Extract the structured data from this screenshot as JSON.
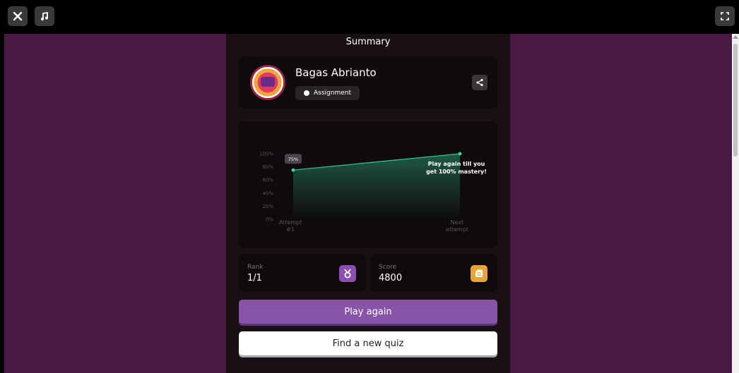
{
  "topbar": {
    "close_icon": "close-icon",
    "music_icon": "music-note-icon",
    "fullscreen_icon": "fullscreen-icon"
  },
  "summary": {
    "title": "Summary"
  },
  "user": {
    "name": "Bagas Abrianto",
    "badge": "Assignment",
    "avatar_icon": "avatar-icon",
    "share_icon": "share-icon"
  },
  "chart_data": {
    "type": "line",
    "x": [
      "Attempt #1",
      "Next attempt"
    ],
    "y_ticks": [
      "100%",
      "80%",
      "60%",
      "40%",
      "20%",
      "0%"
    ],
    "ylim": [
      0,
      100
    ],
    "series": [
      {
        "values": [
          75,
          100
        ]
      }
    ],
    "point_label": "75%",
    "annotation": "Play again till you get 100% mastery!",
    "grid": false,
    "colors": {
      "line": "#2fbf8f",
      "area_top": "#1f5e48"
    }
  },
  "stats": {
    "rank_label": "Rank",
    "rank_value": "1/1",
    "score_label": "Score",
    "score_value": "4800",
    "rank_icon": "medal-icon",
    "score_icon": "coins-icon"
  },
  "actions": {
    "play_again": "Play again",
    "find_quiz": "Find a new quiz"
  },
  "colors": {
    "stage_bg": "#4a1a44",
    "panel_bg": "#181015",
    "primary": "#8854a8",
    "rank_icon_bg": "#8a4fb0",
    "score_icon_bg": "#e8a33a"
  }
}
